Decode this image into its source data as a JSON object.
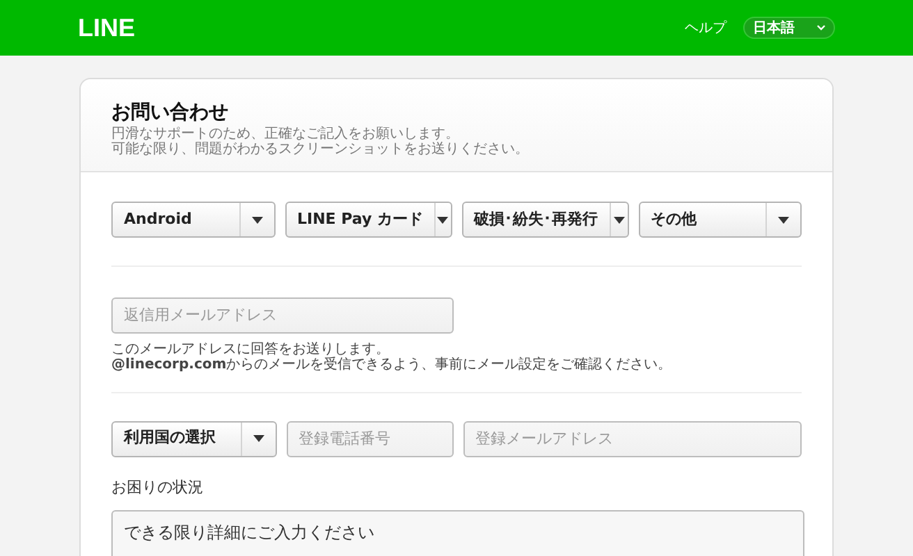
{
  "header": {
    "logo": "LINE",
    "help_link": "ヘルプ",
    "language_select": {
      "value": "日本語"
    }
  },
  "form": {
    "title": "お問い合わせ",
    "intro": [
      "円滑なサポートのため、正確なご記入をお願いします。",
      "可能な限り、問題がわかるスクリーンショットをお送りください。"
    ],
    "category_selects": [
      {
        "value": "Android"
      },
      {
        "value": "LINE Pay カード"
      },
      {
        "value": "破損･紛失･再発行"
      },
      {
        "value": "その他"
      }
    ],
    "reply_email": {
      "placeholder": "返信用メールアドレス"
    },
    "reply_note": [
      "このメールアドレスに回答をお送りします。",
      "**@linecorp.com**からのメールを受信できるよう、事前にメール設定をご確認ください。"
    ],
    "country_select": {
      "value": "利用国の選択"
    },
    "phone_field": {
      "placeholder": "登録電話番号"
    },
    "account_email": {
      "placeholder": "登録メールアドレス"
    },
    "situation_label": "お困りの状況",
    "details": {
      "placeholder": "できる限り詳細にご入力ください"
    }
  }
}
